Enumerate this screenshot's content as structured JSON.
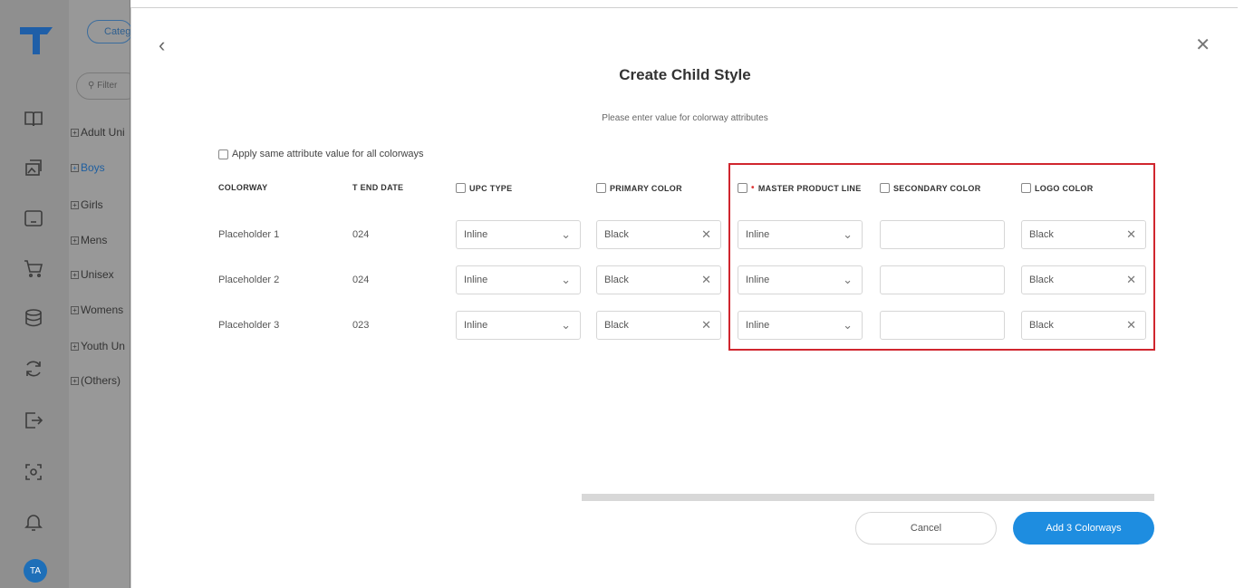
{
  "sidebar": {
    "icons": [
      "book-icon",
      "image-icon",
      "monitor-icon",
      "cart-icon",
      "database-icon",
      "refresh-icon",
      "export-icon",
      "scan-icon",
      "bell-icon"
    ],
    "avatar_initials": "TA"
  },
  "category_panel": {
    "category_button": "Categ",
    "filter_placeholder": "Filter",
    "items": [
      {
        "label": "Adult Uni",
        "active": false
      },
      {
        "label": "Boys",
        "active": true
      },
      {
        "label": "Girls",
        "active": false
      },
      {
        "label": "Mens",
        "active": false
      },
      {
        "label": "Unisex",
        "active": false
      },
      {
        "label": "Womens",
        "active": false
      },
      {
        "label": "Youth Un",
        "active": false
      },
      {
        "label": "(Others)",
        "active": false
      }
    ]
  },
  "modal": {
    "title": "Create Child Style",
    "subtitle": "Please enter value for colorway attributes",
    "apply_all_label": "Apply same attribute value for all colorways",
    "columns": {
      "colorway": "COLORWAY",
      "t_end_date": "T END DATE",
      "upc_type": "UPC TYPE",
      "primary_color": "PRIMARY COLOR",
      "master_product_line": "MASTER PRODUCT LINE",
      "secondary_color": "SECONDARY COLOR",
      "logo_color": "LOGO COLOR"
    },
    "rows": [
      {
        "colorway": "Placeholder 1",
        "t_end_date": "024",
        "upc_type": "Inline",
        "primary_color": "Black",
        "master_product_line": "Inline",
        "secondary_color": "",
        "logo_color": "Black"
      },
      {
        "colorway": "Placeholder 2",
        "t_end_date": "024",
        "upc_type": "Inline",
        "primary_color": "Black",
        "master_product_line": "Inline",
        "secondary_color": "",
        "logo_color": "Black"
      },
      {
        "colorway": "Placeholder 3",
        "t_end_date": "023",
        "upc_type": "Inline",
        "primary_color": "Black",
        "master_product_line": "Inline",
        "secondary_color": "",
        "logo_color": "Black"
      }
    ],
    "cancel_label": "Cancel",
    "add_label": "Add 3 Colorways",
    "highlight_color": "#d0262e",
    "accent_color": "#1e8de0"
  }
}
